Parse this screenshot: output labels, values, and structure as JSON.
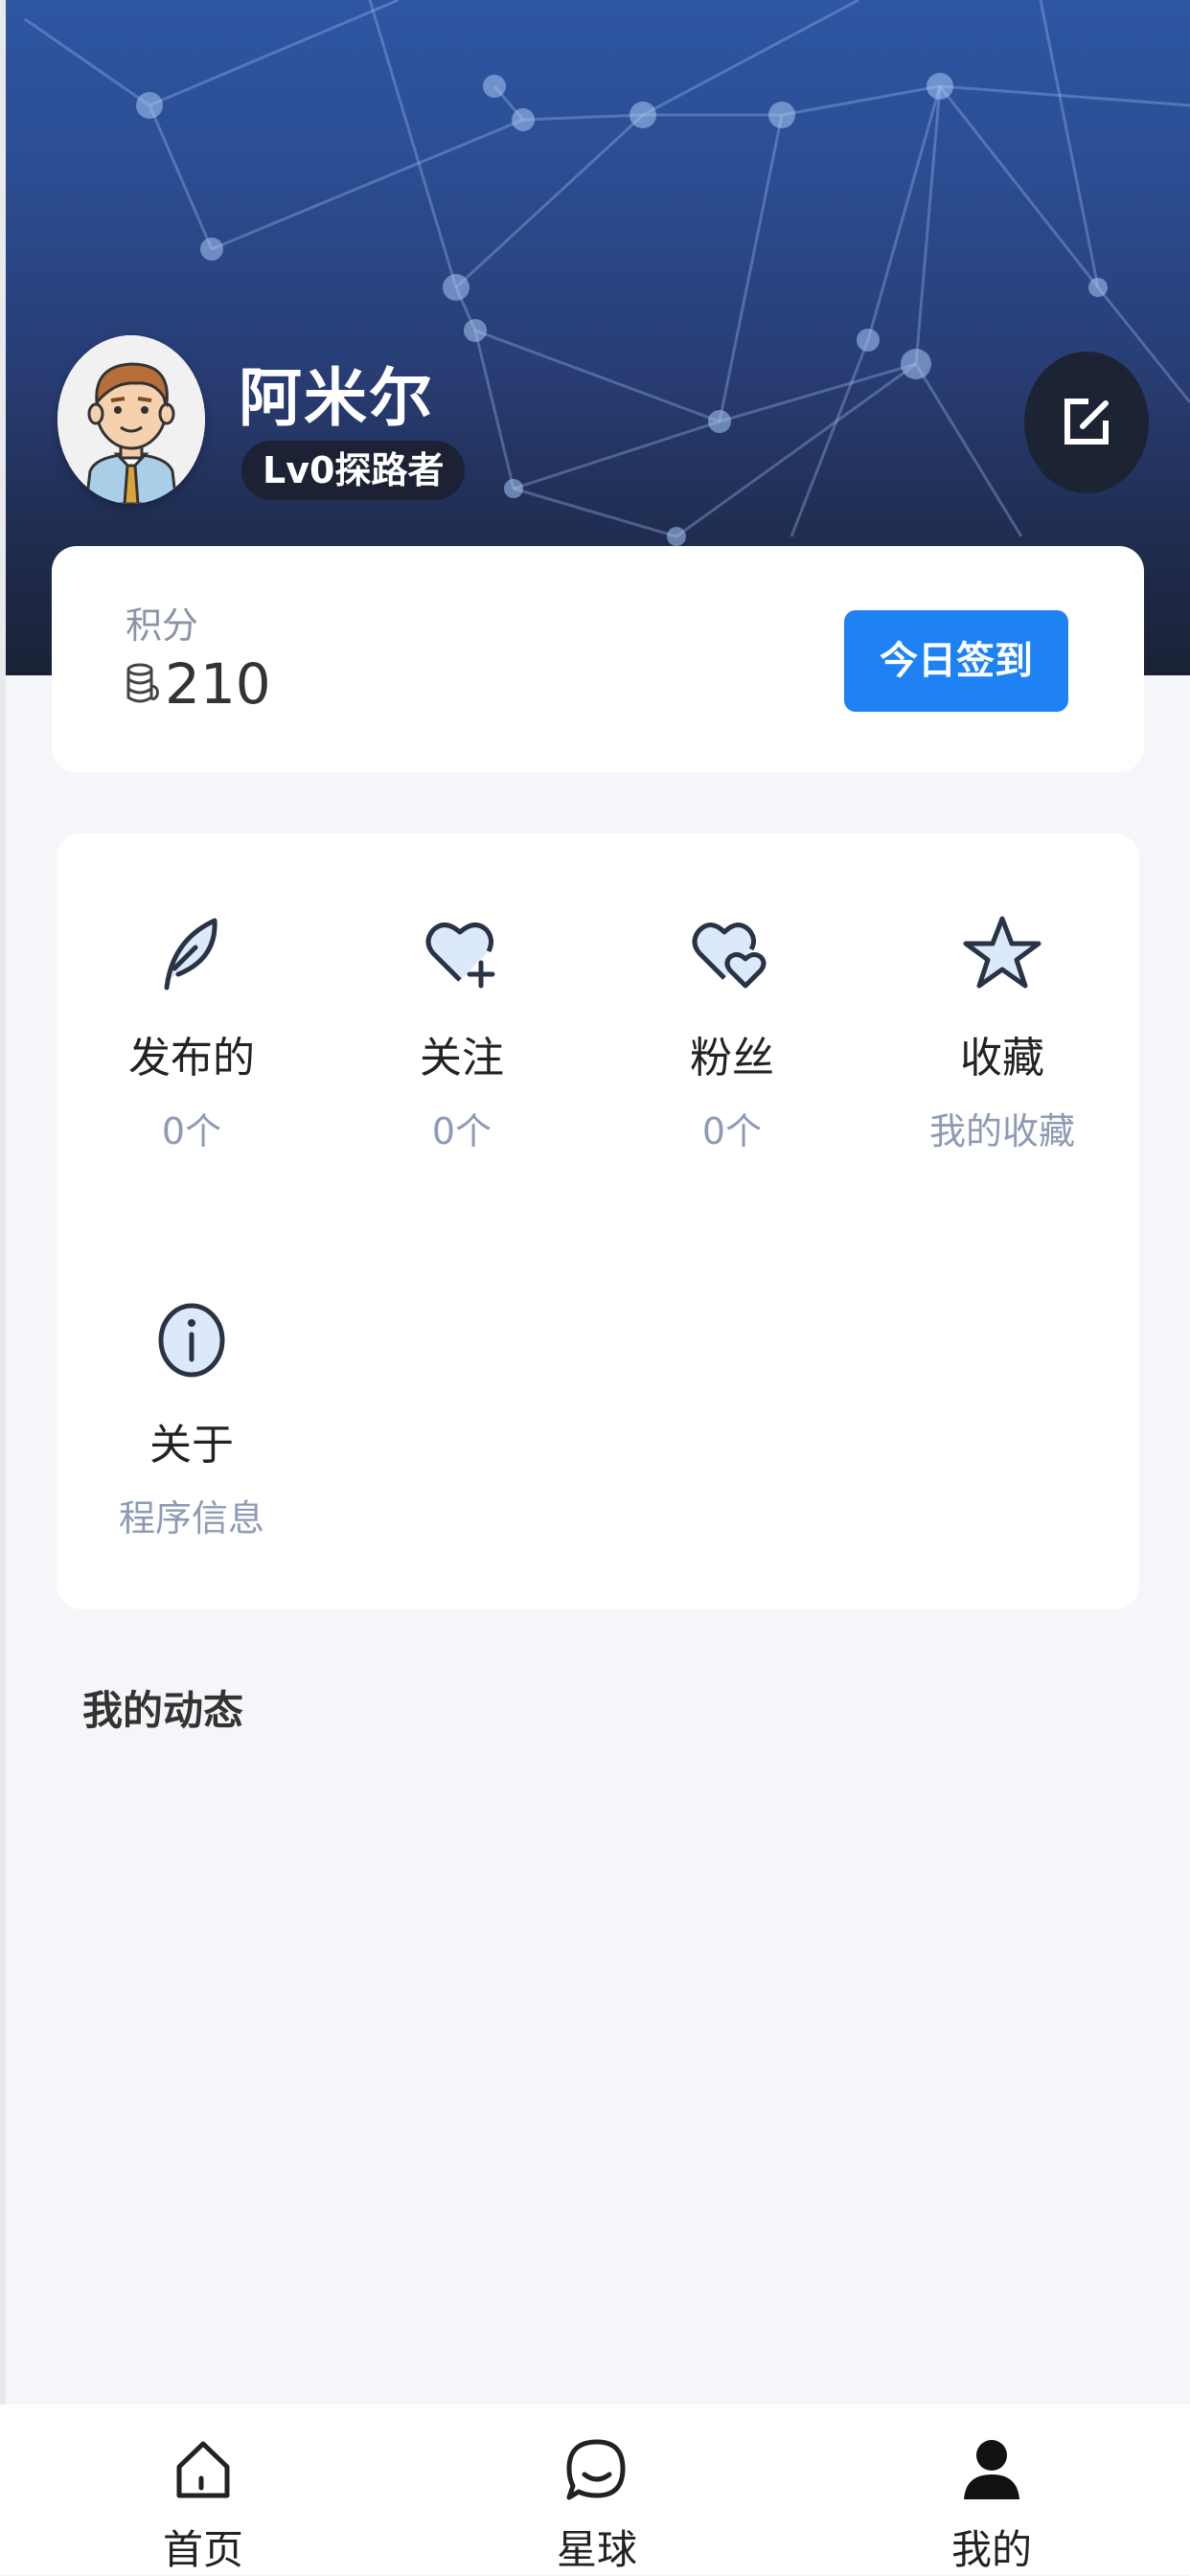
{
  "profile": {
    "name": "阿米尔",
    "level": "Lv0探路者"
  },
  "points": {
    "label": "积分",
    "value": "210",
    "checkin_label": "今日签到"
  },
  "menu": {
    "items": [
      {
        "title": "发布的",
        "sub": "0个",
        "icon": "feather-icon"
      },
      {
        "title": "关注",
        "sub": "0个",
        "icon": "heart-plus-icon"
      },
      {
        "title": "粉丝",
        "sub": "0个",
        "icon": "double-heart-icon"
      },
      {
        "title": "收藏",
        "sub": "我的收藏",
        "icon": "star-icon"
      },
      {
        "title": "关于",
        "sub": "程序信息",
        "icon": "info-icon"
      }
    ]
  },
  "feed": {
    "title": "我的动态"
  },
  "tabbar": {
    "items": [
      {
        "label": "首页",
        "icon": "home-icon"
      },
      {
        "label": "星球",
        "icon": "chat-bubble-icon"
      },
      {
        "label": "我的",
        "icon": "user-icon",
        "active": true
      }
    ]
  },
  "colors": {
    "accent": "#1e82f5",
    "header_top": "#2e56a3",
    "header_bottom": "#1a2136",
    "subtext": "#8d9bb5"
  }
}
